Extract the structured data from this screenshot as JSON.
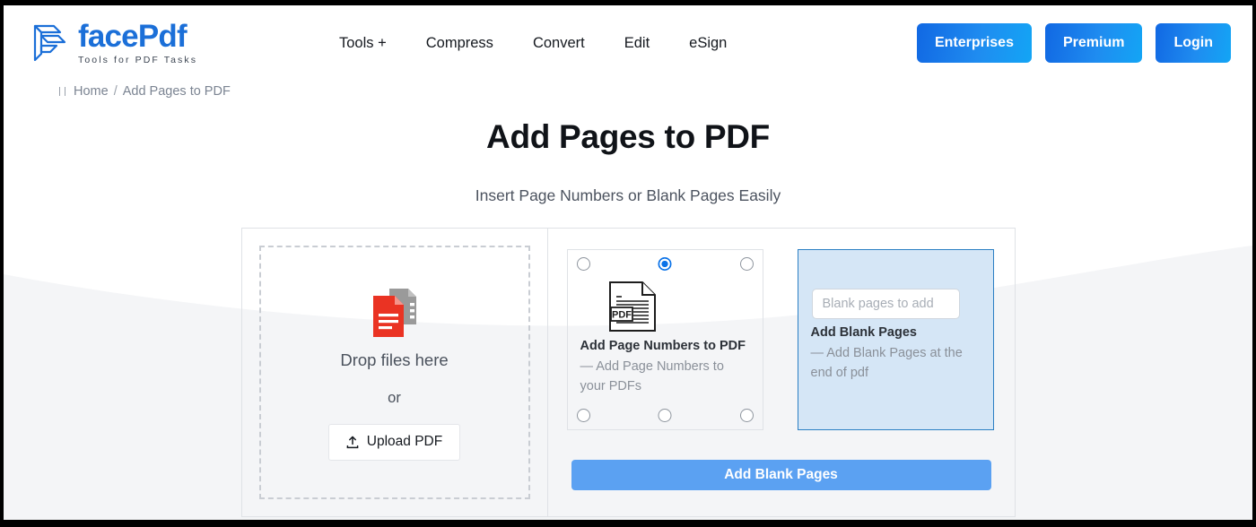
{
  "header": {
    "logo_name": "facePdf",
    "logo_tagline": "Tools for PDF Tasks",
    "nav": [
      {
        "label": "Tools +"
      },
      {
        "label": "Compress"
      },
      {
        "label": "Convert"
      },
      {
        "label": "Edit"
      },
      {
        "label": "eSign"
      }
    ],
    "actions": [
      {
        "label": "Enterprises"
      },
      {
        "label": "Premium"
      },
      {
        "label": "Login"
      }
    ]
  },
  "breadcrumb": {
    "home": "Home",
    "separator": "/",
    "current": "Add Pages to PDF"
  },
  "hero": {
    "title": "Add Pages to PDF",
    "subtitle": "Insert Page Numbers or Blank Pages Easily"
  },
  "dropzone": {
    "drop_text": "Drop files here",
    "or_text": "or",
    "upload_label": "Upload PDF"
  },
  "options": [
    {
      "title": "Add Page Numbers to PDF",
      "description": "— Add Page Numbers to your PDFs",
      "selected": false,
      "position_radios": [
        {
          "position": "top-left",
          "checked": false
        },
        {
          "position": "top-center",
          "checked": true
        },
        {
          "position": "top-right",
          "checked": false
        },
        {
          "position": "bottom-left",
          "checked": false
        },
        {
          "position": "bottom-center",
          "checked": false
        },
        {
          "position": "bottom-right",
          "checked": false
        }
      ]
    },
    {
      "title": "Add Blank Pages",
      "description": "— Add Blank Pages at the end of pdf",
      "selected": true,
      "input_value": "",
      "input_placeholder": "Blank pages to add"
    }
  ],
  "submit": {
    "label": "Add Blank Pages"
  },
  "colors": {
    "brand_blue": "#1b6fd8",
    "cta_gradient_start": "#1168e3",
    "cta_gradient_end": "#13a5f5",
    "submit_blue": "#5ba1f2",
    "selected_card_bg": "#d5e6f6",
    "selected_card_border": "#2b7fc4",
    "radio_on": "#0a72e8",
    "page_bg_lower": "#f4f5f7",
    "pdf_icon_red": "#ea3323"
  }
}
